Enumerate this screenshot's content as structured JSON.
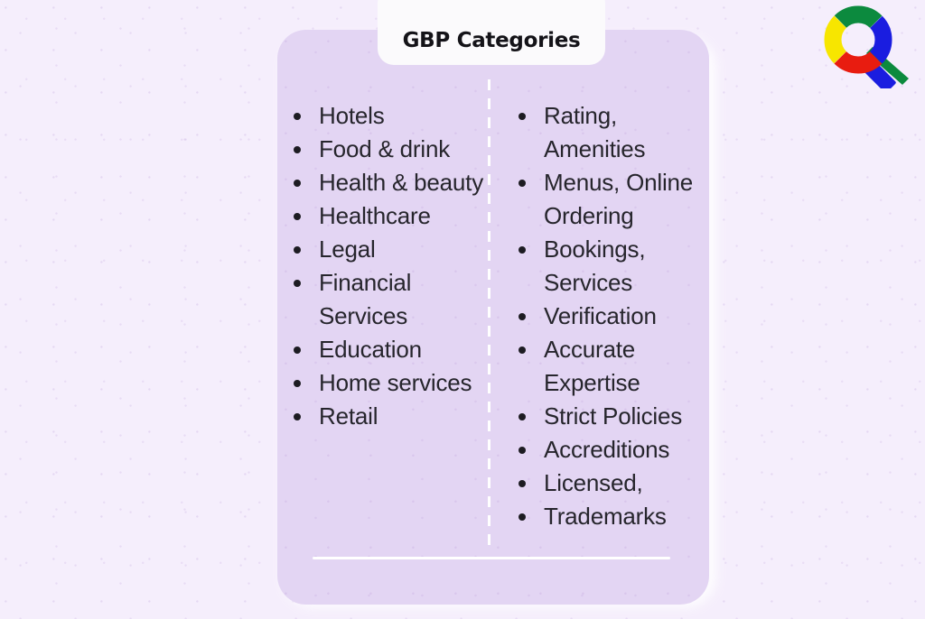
{
  "page": {
    "background_color": "#f5eefc",
    "card_color": "#e3d5f3",
    "text_color": "#26252c"
  },
  "tab": {
    "title": "GBP Categories"
  },
  "columns": {
    "left": {
      "name": "categories-column",
      "items": [
        "Hotels",
        "Food & drink",
        "Health & beauty",
        "Healthcare",
        "Legal",
        "Financial Services",
        "Education",
        "Home services",
        "Retail"
      ]
    },
    "right": {
      "name": "attributes-column",
      "items": [
        "Rating, Amenities",
        "Menus, Online Ordering",
        "Bookings, Services",
        "Verification",
        "Accurate Expertise",
        "Strict Policies",
        "Accreditions",
        "Licensed,",
        "Trademarks"
      ]
    }
  },
  "logo": {
    "name": "google-search-magnifier-icon",
    "colors": {
      "yellow": "#f7e600",
      "red": "#e81c10",
      "green": "#0c8a3e",
      "blue": "#1a1de0"
    }
  }
}
